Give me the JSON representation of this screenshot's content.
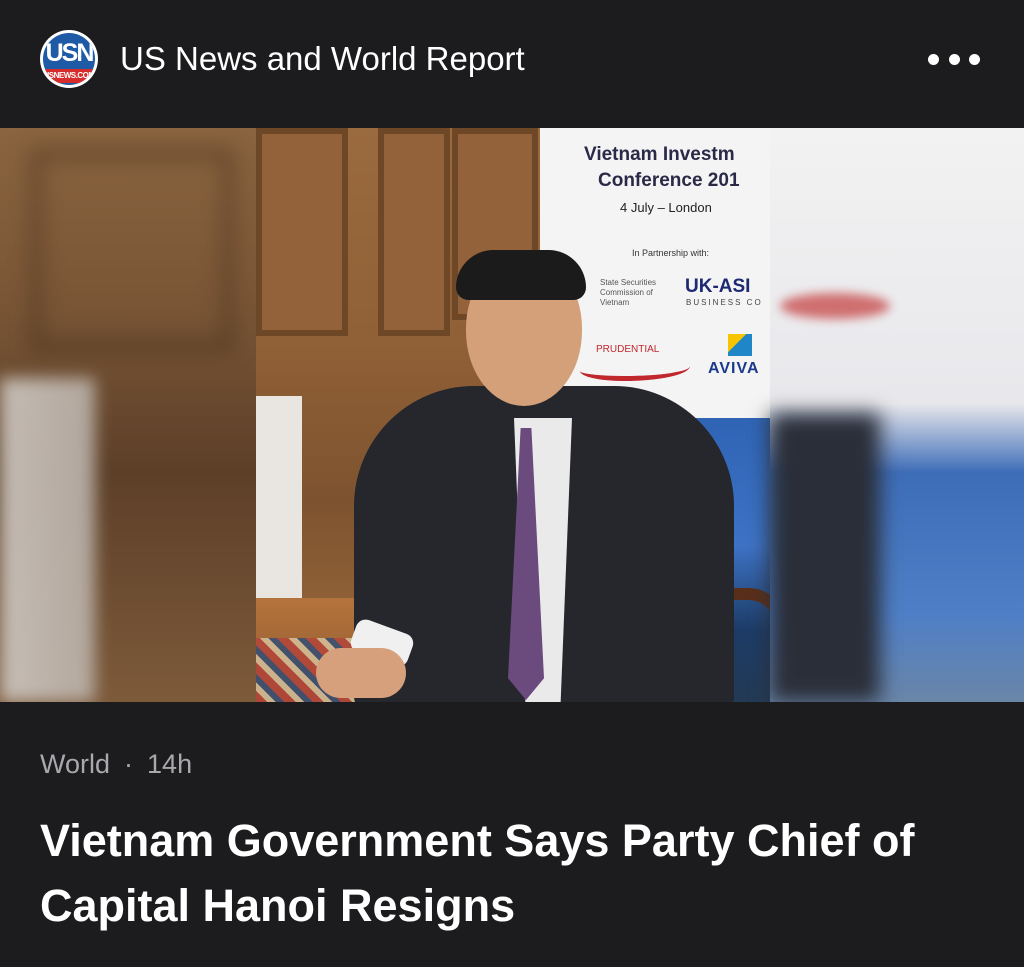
{
  "header": {
    "source_name": "US News and World Report",
    "logo_text": "USN",
    "logo_subtext": "USNEWS.COM",
    "more_icon": "ellipsis-icon"
  },
  "hero": {
    "banner": {
      "title_line1": "Vietnam Investm",
      "title_line2": "Conference 201",
      "date_line": "4 July – London",
      "partnership": "In Partnership with:",
      "ssc": "State Securities Commission of Vietnam",
      "uk_asia": "UK-ASI",
      "uk_asia_sub": "BUSINESS CO",
      "prudential": "PRUDENTIAL",
      "aviva": "AVIVA"
    }
  },
  "article": {
    "category": "World",
    "separator": "·",
    "age": "14h",
    "headline": "Vietnam Government Says Party Chief of Capital Hanoi Resigns"
  }
}
